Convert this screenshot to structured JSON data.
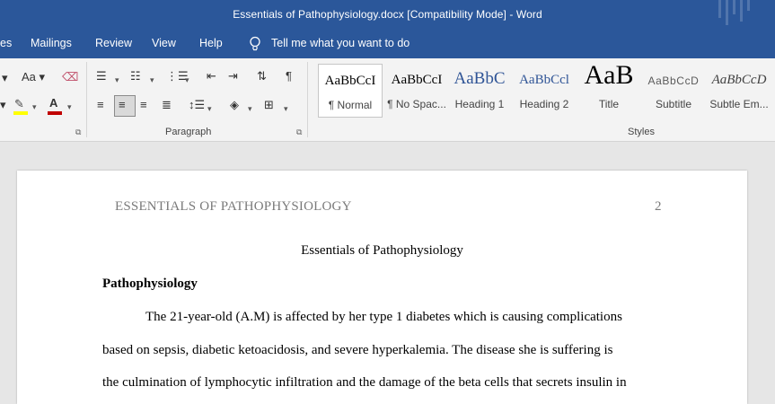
{
  "window": {
    "title": "Essentials of Pathophysiology.docx [Compatibility Mode]  -  Word"
  },
  "menu": {
    "tabs": [
      "es",
      "Mailings",
      "Review",
      "View",
      "Help"
    ],
    "tell_me": "Tell me what you want to do"
  },
  "ribbon": {
    "font_group": {
      "size_label": "Aa"
    },
    "paragraph_group": {
      "label": "Paragraph"
    },
    "styles_group": {
      "label": "Styles",
      "items": [
        {
          "sample": "AaBbCcI",
          "label": "¶ Normal",
          "selected": true
        },
        {
          "sample": "AaBbCcI",
          "label": "¶ No Spac..."
        },
        {
          "sample": "AaBbC",
          "label": "Heading 1"
        },
        {
          "sample": "AaBbCcl",
          "label": "Heading 2"
        },
        {
          "sample": "AaB",
          "label": "Title"
        },
        {
          "sample": "AaBbCcD",
          "label": "Subtitle"
        },
        {
          "sample": "AaBbCcD",
          "label": "Subtle Em..."
        }
      ]
    }
  },
  "document": {
    "header_text": "ESSENTIALS OF PATHOPHYSIOLOGY",
    "page_number": "2",
    "title": "Essentials of Pathophysiology",
    "heading": "Pathophysiology",
    "lines": [
      "The 21-year-old (A.M) is affected by her type 1 diabetes which is causing complications",
      "based on sepsis, diabetic ketoacidosis, and severe hyperkalemia. The disease she is suffering is",
      "the culmination of lymphocytic infiltration and the damage of the beta cells that secrets insulin in"
    ]
  },
  "colors": {
    "accent": "#2b579a"
  }
}
